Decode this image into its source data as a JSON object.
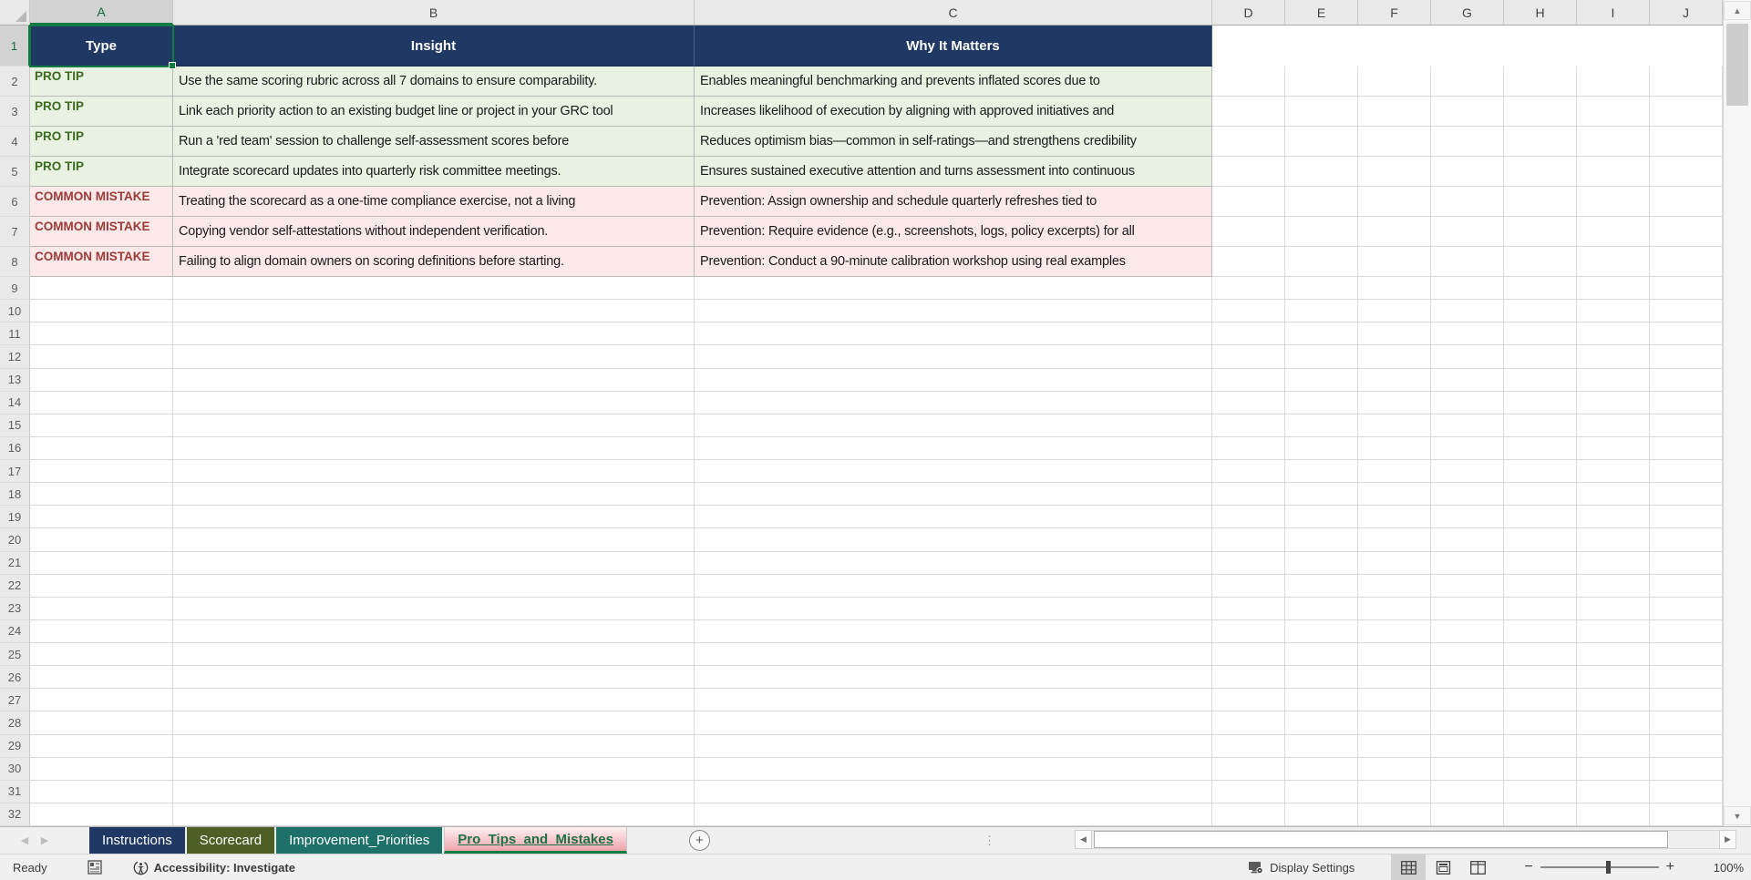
{
  "sheet": {
    "columns": [
      "A",
      "B",
      "C",
      "D",
      "E",
      "F",
      "G",
      "H",
      "I",
      "J"
    ],
    "selected_cell": "A1",
    "header_row": {
      "n": "1",
      "type": "Type",
      "insight": "Insight",
      "why": "Why It Matters"
    },
    "rows": [
      {
        "n": "2",
        "type": "PRO TIP",
        "insight": "Use the same scoring rubric across all 7 domains to ensure comparability.",
        "why": "Enables meaningful benchmarking and prevents inflated scores due to"
      },
      {
        "n": "3",
        "type": "PRO TIP",
        "insight": "Link each priority action to an existing budget line or project in your GRC tool",
        "why": "Increases likelihood of execution by aligning with approved initiatives and"
      },
      {
        "n": "4",
        "type": "PRO TIP",
        "insight": "Run a 'red team' session to challenge self-assessment scores before",
        "why": "Reduces optimism bias—common in self-ratings—and strengthens credibility"
      },
      {
        "n": "5",
        "type": "PRO TIP",
        "insight": "Integrate scorecard updates into quarterly risk committee meetings.",
        "why": "Ensures sustained executive attention and turns assessment into continuous"
      },
      {
        "n": "6",
        "type": "COMMON MISTAKE",
        "insight": "Treating the scorecard as a one-time compliance exercise, not a living",
        "why": "Prevention: Assign ownership and schedule quarterly refreshes tied to"
      },
      {
        "n": "7",
        "type": "COMMON MISTAKE",
        "insight": "Copying vendor self-attestations without independent verification.",
        "why": "Prevention: Require evidence (e.g., screenshots, logs, policy excerpts) for all"
      },
      {
        "n": "8",
        "type": "COMMON MISTAKE",
        "insight": "Failing to align domain owners on scoring definitions before starting.",
        "why": "Prevention: Conduct a 90-minute calibration workshop using real examples"
      }
    ],
    "empty_rows": {
      "from": 9,
      "to": 32
    }
  },
  "tabs": {
    "items": [
      {
        "label": "Instructions",
        "active": false,
        "color": "#1F3864"
      },
      {
        "label": "Scorecard",
        "active": false,
        "color": "#4E5F26"
      },
      {
        "label": "Improvement_Priorities",
        "active": false,
        "color": "#1E7168"
      },
      {
        "label": "Pro_Tips_and_Mistakes",
        "active": true,
        "color": "#EFA3AB"
      }
    ],
    "new_sheet_label": "+"
  },
  "status": {
    "ready": "Ready",
    "accessibility": "Accessibility: Investigate",
    "display_settings": "Display Settings",
    "zoom_level": "100%"
  },
  "colors": {
    "header_fill": "#1F3864",
    "tip_fill": "#E9F2E2",
    "tip_text": "#3A6B1F",
    "mistake_fill": "#FBE9EA",
    "mistake_text": "#9A3B38",
    "selection_green": "#107C41"
  }
}
